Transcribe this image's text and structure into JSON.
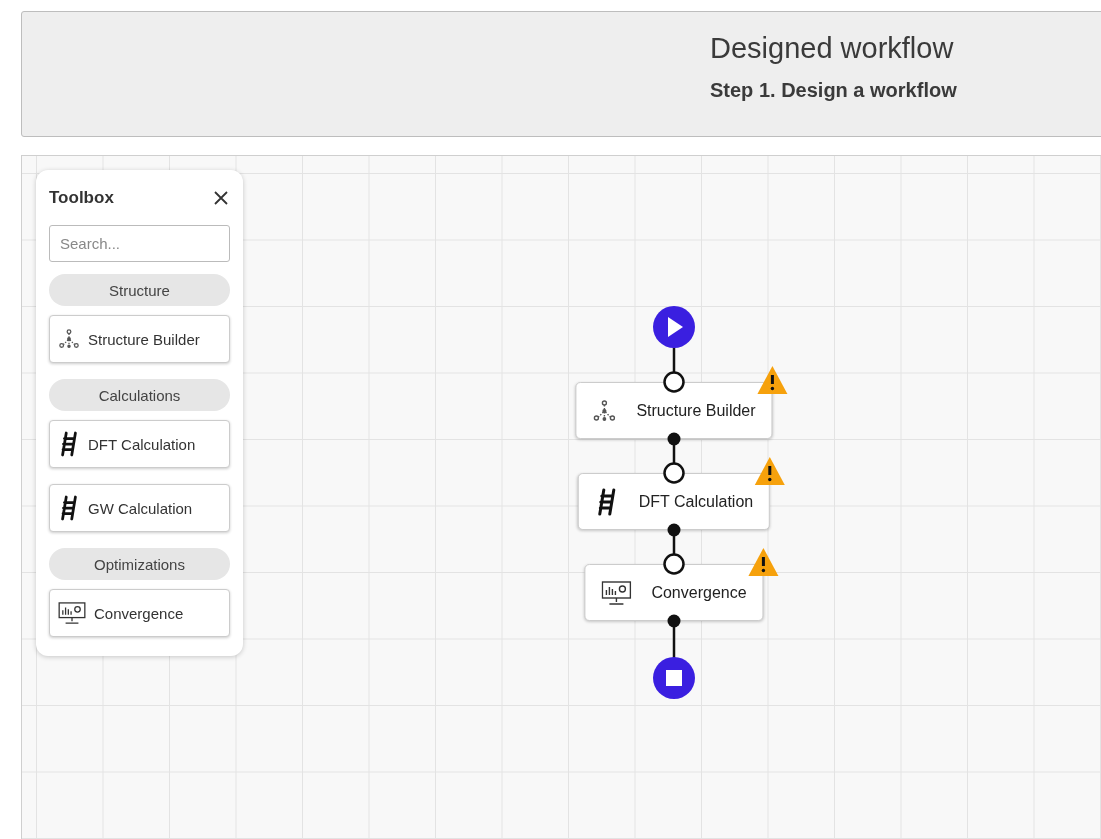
{
  "header": {
    "title": "Designed workflow",
    "subtitle": "Step 1. Design a workflow"
  },
  "toolbox": {
    "title": "Toolbox",
    "search": {
      "placeholder": "Search..."
    },
    "groups": [
      {
        "category": "Structure",
        "items": [
          {
            "label": "Structure Builder",
            "kind": "structure"
          }
        ]
      },
      {
        "category": "Calculations",
        "items": [
          {
            "label": "DFT Calculation",
            "kind": "ladder"
          },
          {
            "label": "GW Calculation",
            "kind": "ladder"
          }
        ]
      },
      {
        "category": "Optimizations",
        "items": [
          {
            "label": "Convergence",
            "kind": "monitor"
          }
        ]
      }
    ]
  },
  "workflow": {
    "nodes": [
      {
        "label": "Structure Builder",
        "kind": "structure",
        "warning": true
      },
      {
        "label": "DFT Calculation",
        "kind": "ladder",
        "warning": true
      },
      {
        "label": "Convergence",
        "kind": "monitor",
        "warning": true
      }
    ]
  }
}
